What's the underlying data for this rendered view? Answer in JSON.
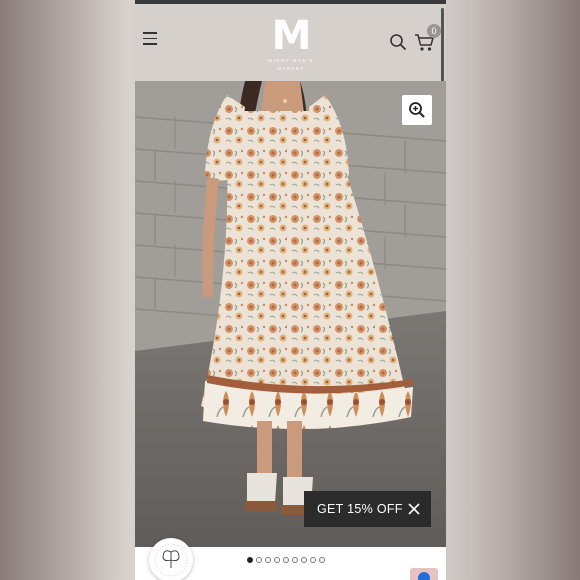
{
  "header": {
    "logo_letter": "M",
    "logo_tagline_1": "MINDY MAE'S",
    "logo_tagline_2": "MARKET",
    "cart_count": "0",
    "menu_icon": "hamburger-icon",
    "search_icon": "search-icon",
    "cart_icon": "cart-icon"
  },
  "product": {
    "image_description_icon": "dress-photo",
    "zoom_icon": "zoom-in-icon"
  },
  "promo": {
    "label": "GET 15% OFF",
    "close_icon": "close-icon"
  },
  "carousel": {
    "total": 9,
    "active_index": 0
  },
  "colors": {
    "header_bg": "#d6d0cd",
    "promo_bg": "#2b2b2b",
    "accent_blue": "#1e6fd9"
  }
}
